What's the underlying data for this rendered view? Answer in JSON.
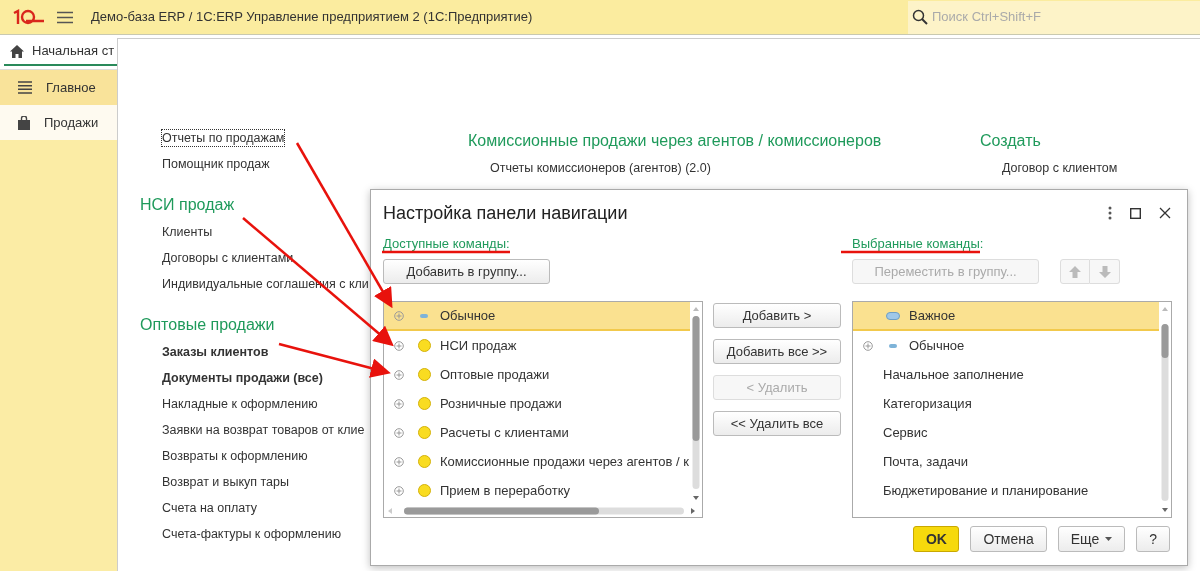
{
  "app_bar": {
    "title": "Демо-база ERP / 1С:ERP Управление предприятием 2  (1С:Предприятие)",
    "search": {
      "placeholder": "Поиск Ctrl+Shift+F"
    }
  },
  "tabs": [
    {
      "label": "Начальная ст",
      "selected": true
    }
  ],
  "sidebar": {
    "items": [
      {
        "label": "Главное",
        "selected": true
      },
      {
        "label": "Продажи",
        "selected": false
      }
    ]
  },
  "columns": [
    {
      "sections": [
        {
          "items": [
            {
              "label": "Отчеты по продажам",
              "bold": false,
              "focused": true
            },
            {
              "label": "Помощник продаж",
              "bold": false,
              "focused": false
            }
          ]
        },
        {
          "title": "НСИ продаж",
          "items": [
            {
              "label": "Клиенты",
              "bold": false,
              "focused": false
            },
            {
              "label": "Договоры с клиентами",
              "bold": false,
              "focused": false
            },
            {
              "label": "Индивидуальные соглашения с кли",
              "bold": false,
              "focused": false
            }
          ]
        },
        {
          "title": "Оптовые продажи",
          "items": [
            {
              "label": "Заказы клиентов",
              "bold": true,
              "focused": false
            },
            {
              "label": "Документы продажи (все)",
              "bold": true,
              "focused": false
            },
            {
              "label": "Накладные к оформлению",
              "bold": false,
              "focused": false
            },
            {
              "label": "Заявки на возврат товаров от клие",
              "bold": false,
              "focused": false
            },
            {
              "label": "Возвраты к оформлению",
              "bold": false,
              "focused": false
            },
            {
              "label": "Возврат и выкуп тары",
              "bold": false,
              "focused": false
            },
            {
              "label": "Счета на оплату",
              "bold": false,
              "focused": false
            },
            {
              "label": "Счета-фактуры к оформлению",
              "bold": false,
              "focused": false
            }
          ]
        }
      ]
    },
    {
      "sections": [
        {
          "title": "Комиссионные продажи через агентов / комиссионеров",
          "items": [
            {
              "label": "Отчеты комиссионеров (агентов) (2.0)",
              "bold": false,
              "focused": false
            }
          ]
        }
      ]
    },
    {
      "sections": [
        {
          "title": "Создать",
          "items": [
            {
              "label": "Договор с клиентом",
              "bold": false,
              "focused": false
            }
          ]
        }
      ]
    }
  ],
  "dialog": {
    "title": "Настройка панели навигации",
    "available": {
      "label": "Доступные команды:",
      "button": {
        "label": "Добавить в группу...",
        "disabled": false
      },
      "rows": [
        {
          "label": "Обычное",
          "kind": "dash",
          "expandable": true,
          "selected": true
        },
        {
          "label": "НСИ продаж",
          "kind": "dot",
          "expandable": true,
          "selected": false
        },
        {
          "label": "Оптовые продажи",
          "kind": "dot",
          "expandable": true,
          "selected": false
        },
        {
          "label": "Розничные продажи",
          "kind": "dot",
          "expandable": true,
          "selected": false
        },
        {
          "label": "Расчеты с клиентами",
          "kind": "dot",
          "expandable": true,
          "selected": false
        },
        {
          "label": "Комиссионные продажи через агентов / к",
          "kind": "dot",
          "expandable": true,
          "selected": false
        },
        {
          "label": "Прием в переработку",
          "kind": "dot",
          "expandable": true,
          "selected": false
        }
      ]
    },
    "transfer_buttons": [
      {
        "label": "Добавить >",
        "disabled": false
      },
      {
        "label": "Добавить все >>",
        "disabled": false
      },
      {
        "label": "< Удалить",
        "disabled": true
      },
      {
        "label": "<< Удалить все",
        "disabled": false
      }
    ],
    "chosen": {
      "label": "Выбранные команды:",
      "button": {
        "label": "Переместить в группу...",
        "disabled": true
      },
      "move_buttons": [
        {
          "kind": "up",
          "disabled": true
        },
        {
          "kind": "down",
          "disabled": true
        }
      ],
      "rows": [
        {
          "label": "Важное",
          "kind": "block",
          "expandable": false,
          "selected": true
        },
        {
          "label": "Обычное",
          "kind": "dash",
          "expandable": true,
          "selected": false
        },
        {
          "label": "Начальное заполнение",
          "kind": "command",
          "expandable": false,
          "selected": false
        },
        {
          "label": "Категоризация",
          "kind": "command",
          "expandable": false,
          "selected": false
        },
        {
          "label": "Сервис",
          "kind": "command",
          "expandable": false,
          "selected": false
        },
        {
          "label": "Почта, задачи",
          "kind": "command",
          "expandable": false,
          "selected": false
        },
        {
          "label": "Бюджетирование и планирование",
          "kind": "command",
          "expandable": false,
          "selected": false
        }
      ]
    },
    "footer_buttons": [
      {
        "label": "OK",
        "kind": "default"
      },
      {
        "label": "Отмена",
        "kind": "plain"
      },
      {
        "label": "Еще",
        "kind": "menu"
      },
      {
        "label": "?",
        "kind": "plain"
      }
    ]
  }
}
